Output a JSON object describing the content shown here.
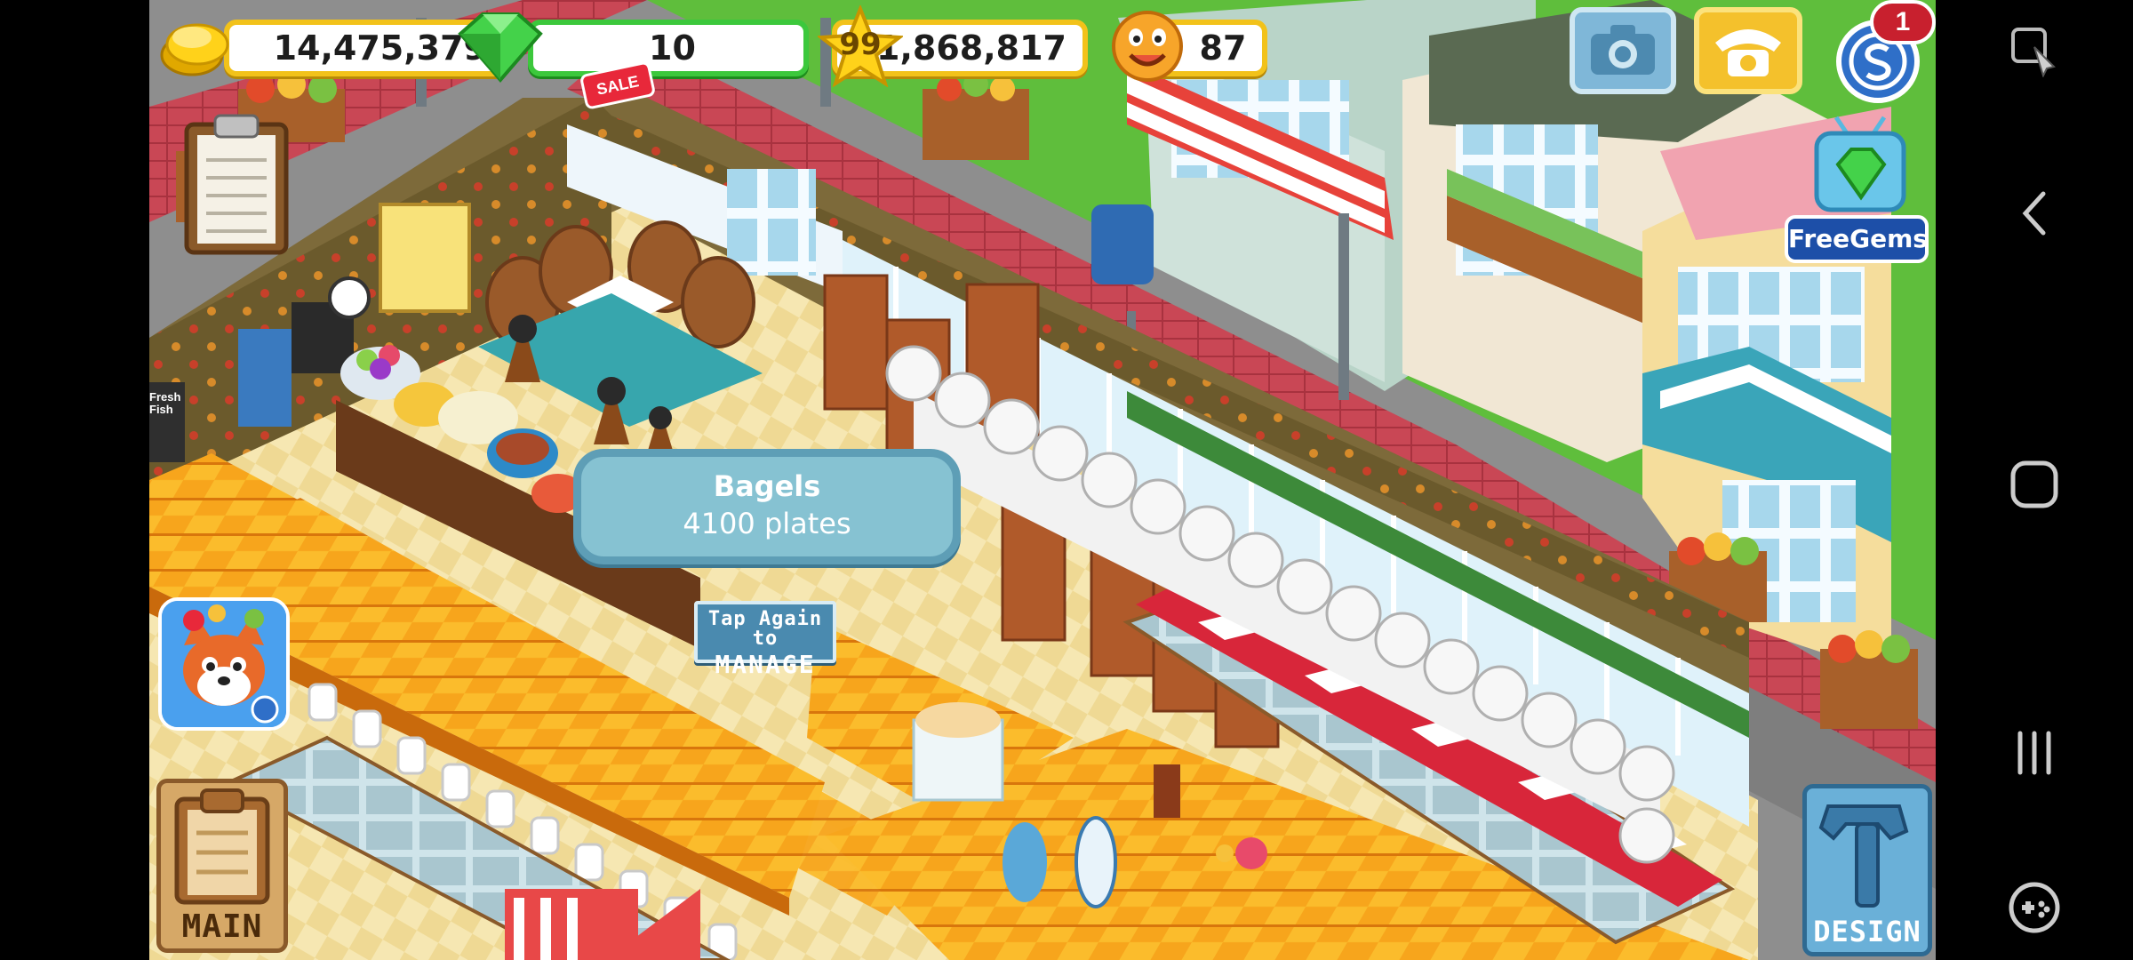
{
  "hud": {
    "coins": "14,475,379",
    "gems": "10",
    "sale_label": "SALE",
    "level": "99",
    "experience": "1,868,817",
    "happiness": "87",
    "notification_count": "1",
    "free_gems_label": "FreeGems"
  },
  "popup": {
    "item_name": "Bagels",
    "item_detail": "4100 plates",
    "manage_line1": "Tap Again to",
    "manage_line2": "MANAGE"
  },
  "buttons": {
    "main_label": "MAIN",
    "design_label": "DESIGN"
  },
  "scene": {
    "street_sign_lines": [
      "Fresh",
      "Fish"
    ]
  },
  "colors": {
    "coin_gold": "#f2c21a",
    "gem_green": "#3cc83c",
    "tile_orange": "#f7a51c",
    "popup_blue": "#86c2d2",
    "grass_green": "#5fbe3c"
  },
  "icons": {
    "coins": "coin-stack-icon",
    "gems": "green-gem-icon",
    "level": "star-icon",
    "happiness": "smiley-face-icon",
    "camera": "camera-icon",
    "phone": "telephone-icon",
    "profile": "s-profile-icon",
    "missions": "clipboard-icon",
    "ad_game": "fox-game-icon",
    "nav": [
      "game-assistant-icon",
      "back-icon",
      "home-icon",
      "recents-icon",
      "game-launcher-icon"
    ]
  }
}
